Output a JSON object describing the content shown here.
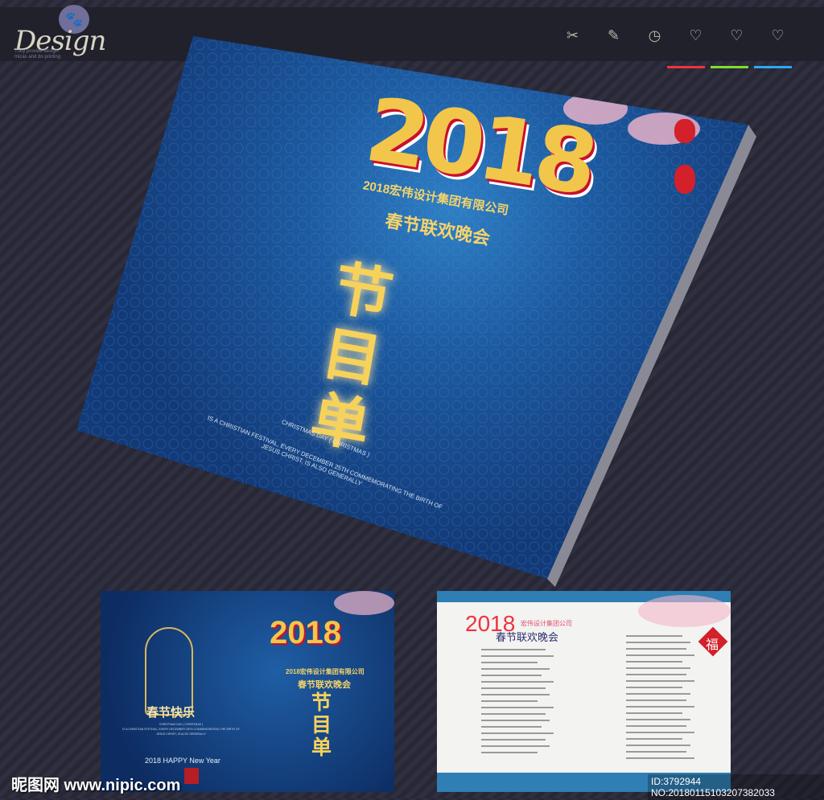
{
  "header": {
    "logo_text": "Design",
    "logo_tagline": "They provide design micas and do printing",
    "icons": [
      {
        "name": "scissors-icon",
        "glyph": "✂"
      },
      {
        "name": "pencil-icon",
        "glyph": "✎"
      },
      {
        "name": "check-circle-icon",
        "glyph": "◷"
      },
      {
        "name": "heart-icon",
        "glyph": "♡"
      },
      {
        "name": "heart-add-icon",
        "glyph": "♡"
      },
      {
        "name": "heart-remove-icon",
        "glyph": "♡"
      }
    ],
    "accent_colors": [
      "#ef3340",
      "#7ee02a",
      "#2ea9f0"
    ]
  },
  "cover": {
    "year": "2018",
    "company": "2018宏伟设计集团有限公司",
    "event": "春节联欢晚会",
    "title": "节目单",
    "english": [
      "CHRISTMAS DAY ( CHRISTMAS )",
      "IS A CHRISTIAN FESTIVAL, EVERY DECEMBER 25TH COMMEMORATING THE BIRTH OF",
      "JESUS CHRIST, IS ALSO GENERALLY"
    ]
  },
  "back_cover": {
    "greeting": "春节快乐",
    "english": [
      "CHRISTMAS DAY ( CHRISTMAS )",
      "IS A CHRISTIAN FESTIVAL, EVERY DECEMBER 25TH COMMEMORATING THE BIRTH OF",
      "JESUS CHRIST, IS ALSO GENERALLY"
    ],
    "happy": "2018 HAPPY New Year",
    "year": "2018",
    "company": "2018宏伟设计集团有限公司",
    "event": "春节联欢晚会",
    "title": "节目单"
  },
  "program_sheet": {
    "year": "2018",
    "company": "宏伟设计集团公司",
    "event": "春节联欢晚会",
    "fu": "福"
  },
  "watermark": {
    "site": "昵图网 www.nipic.com",
    "id": "ID:3792944 NO:20180115103207382033"
  }
}
